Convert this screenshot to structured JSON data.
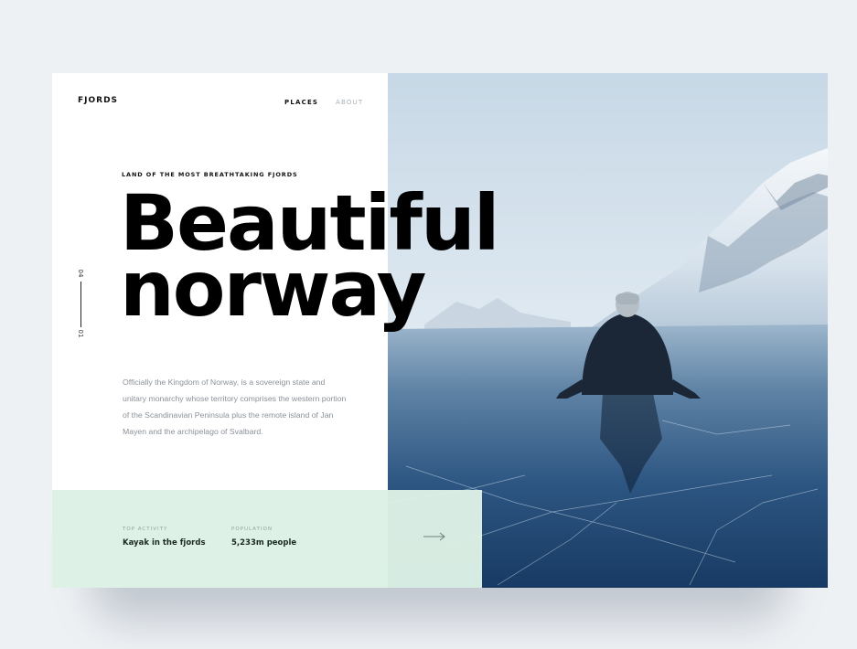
{
  "brand": {
    "logo": "FJORDS"
  },
  "nav": {
    "items": [
      {
        "label": "PLACES",
        "active": true
      },
      {
        "label": "ABOUT",
        "active": false
      }
    ]
  },
  "hero": {
    "tagline": "LAND OF THE MOST BREATHTAKING FJORDS",
    "headline_line1": "Beautiful",
    "headline_line2": "norway",
    "description": "Officially the Kingdom of Norway, is a sovereign state and unitary monarchy whose territory comprises the western portion of the Scandinavian Peninsula plus the remote island of Jan Mayen and the archipelago of Svalbard."
  },
  "slider": {
    "current": "01",
    "total": "04"
  },
  "info": {
    "activity_label": "TOP ACTIVITY",
    "activity_value": "Kayak in the fjords",
    "population_label": "POPULATION",
    "population_value": "5,233m people",
    "next_icon": "arrow-right-icon"
  },
  "colors": {
    "background": "#eef1f4",
    "info_panel": "#ddf1e5",
    "text_dark": "#000000",
    "text_muted": "#8a9199",
    "nav_inactive": "#a9b0b6"
  }
}
